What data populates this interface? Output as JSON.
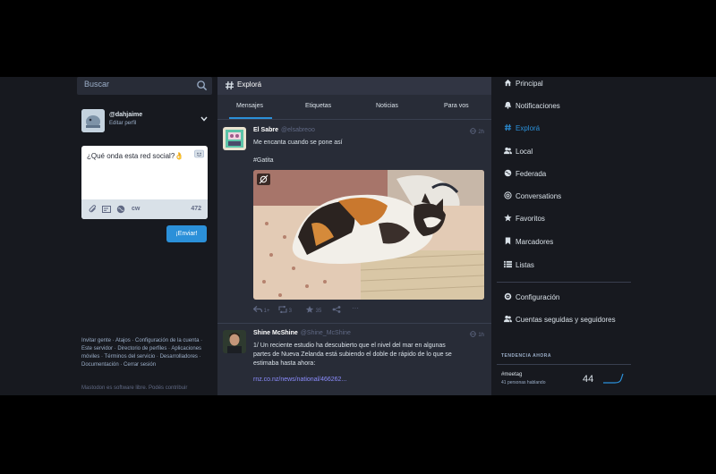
{
  "search": {
    "placeholder": "Buscar"
  },
  "profile": {
    "handle": "@dahjaime",
    "edit_label": "Editar perfil"
  },
  "composer": {
    "text": "¿Qué onda esta red social?👌",
    "cw_label": "cw",
    "char_count": "472",
    "send_label": "¡Enviar!"
  },
  "footer": {
    "links": "Invitar gente · Atajos · Configuración de la cuenta · Este servidor · Directorio de perfiles · Aplicaciones móviles · Términos del servicio · Desarrolladores · Documentación · Cerrar sesión",
    "note": "Mastodon es software libre. Podés contribuir"
  },
  "column": {
    "title": "Explorá",
    "tabs": [
      "Mensajes",
      "Etiquetas",
      "Noticias",
      "Para vos"
    ]
  },
  "statuses": [
    {
      "name": "El Sabre",
      "acct": "@elsabreoo",
      "time": "2h",
      "lines": [
        "Me encanta cuando se pone así",
        "",
        "#Gatita"
      ],
      "reply_count": "1+",
      "boost_count": "3",
      "fav_count": "35"
    },
    {
      "name": "Shine McShine",
      "acct": "@Shine_McShine",
      "time": "1h",
      "lines": [
        "1/ Un reciente estudio ha descubierto que el nivel del mar en algunas",
        "partes de Nueva Zelanda está subiendo el doble de rápido de lo que se",
        "estimaba hasta ahora:"
      ],
      "link": "rnz.co.nz/news/national/466262..."
    }
  ],
  "nav": [
    {
      "label": "Principal",
      "icon": "home-icon"
    },
    {
      "label": "Notificaciones",
      "icon": "bell-icon"
    },
    {
      "label": "Explorá",
      "icon": "hashtag-icon"
    },
    {
      "label": "Local",
      "icon": "users-icon"
    },
    {
      "label": "Federada",
      "icon": "globe-icon"
    },
    {
      "label": "Conversations",
      "icon": "at-icon"
    },
    {
      "label": "Favoritos",
      "icon": "star-icon"
    },
    {
      "label": "Marcadores",
      "icon": "bookmark-icon"
    },
    {
      "label": "Listas",
      "icon": "list-icon"
    },
    {
      "label": "Configuración",
      "icon": "gear-icon"
    },
    {
      "label": "Cuentas seguidas y seguidores",
      "icon": "users-icon"
    }
  ],
  "trending": {
    "title": "TENDENCIA AHORA",
    "tag": "#meetag",
    "sub": "41 personas hablando",
    "count": "44"
  },
  "colors": {
    "accent": "#2b90d9",
    "background": "#17191f",
    "column": "#282c37"
  }
}
